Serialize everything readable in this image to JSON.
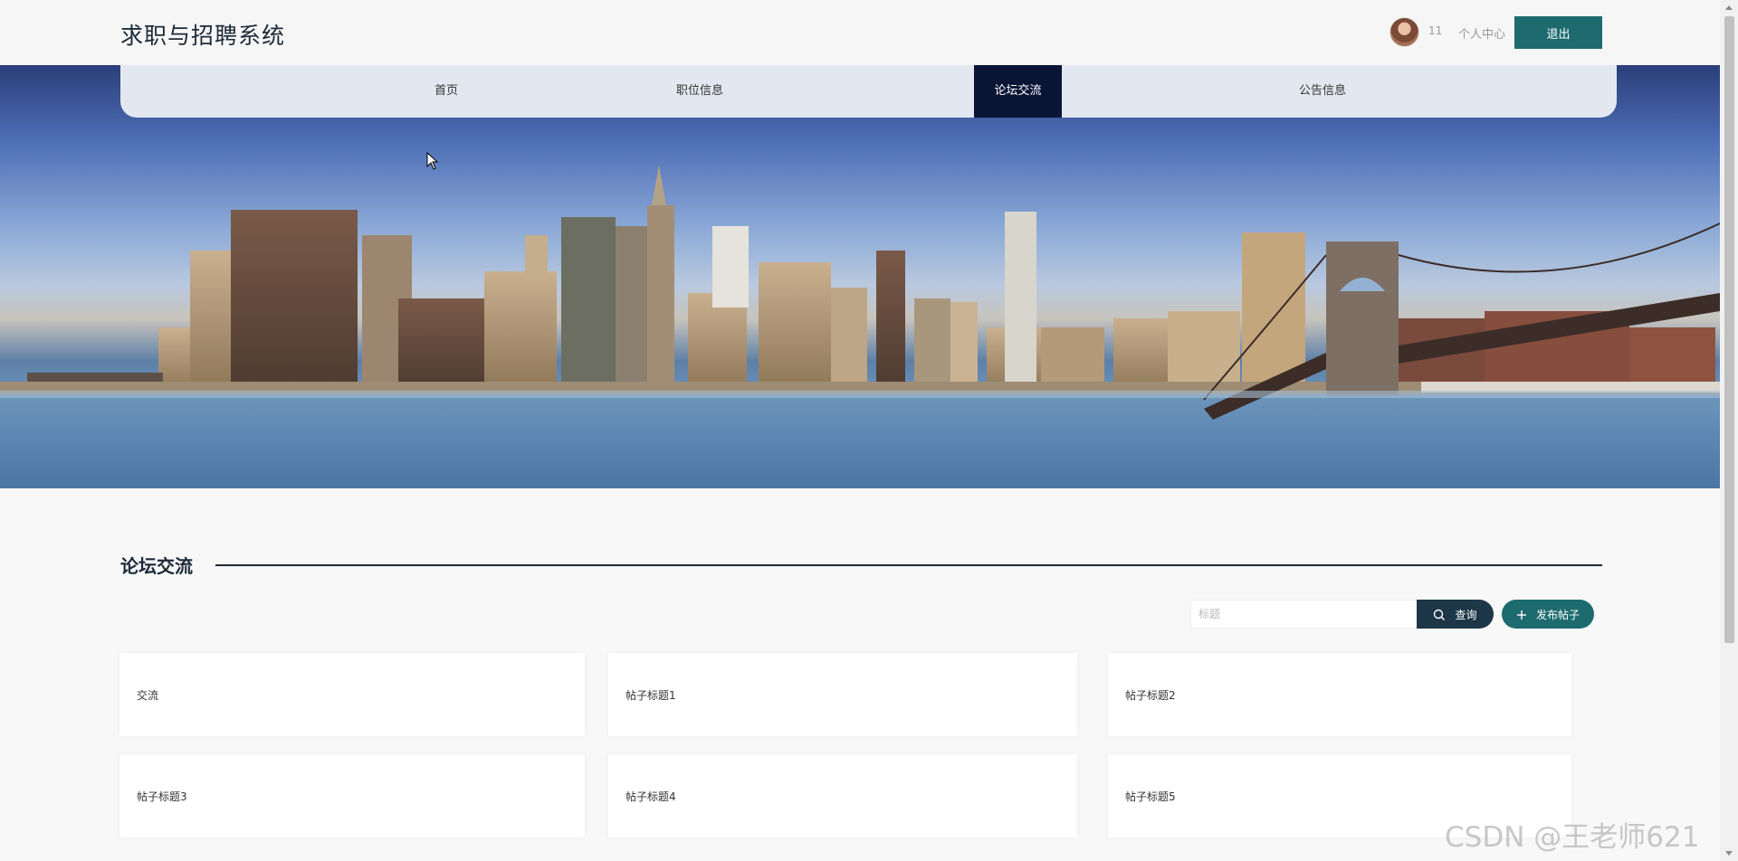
{
  "header": {
    "site_title": "求职与招聘系统",
    "username": "11",
    "profile_label": "个人中心",
    "logout_label": "退出"
  },
  "nav": {
    "items": [
      {
        "label": "首页",
        "active": false
      },
      {
        "label": "职位信息",
        "active": false
      },
      {
        "label": "论坛交流",
        "active": true
      },
      {
        "label": "公告信息",
        "active": false
      }
    ]
  },
  "section": {
    "title": "论坛交流"
  },
  "search": {
    "placeholder": "标题",
    "search_label": "查询",
    "post_label": "发布帖子"
  },
  "posts": [
    {
      "title": "交流"
    },
    {
      "title": "帖子标题1"
    },
    {
      "title": "帖子标题2"
    },
    {
      "title": "帖子标题3"
    },
    {
      "title": "帖子标题4"
    },
    {
      "title": "帖子标题5"
    }
  ],
  "watermark": "CSDN @王老师621",
  "colors": {
    "accent_teal": "#1d6b6e",
    "nav_active": "#0a1435",
    "search_btn": "#1d3748"
  }
}
